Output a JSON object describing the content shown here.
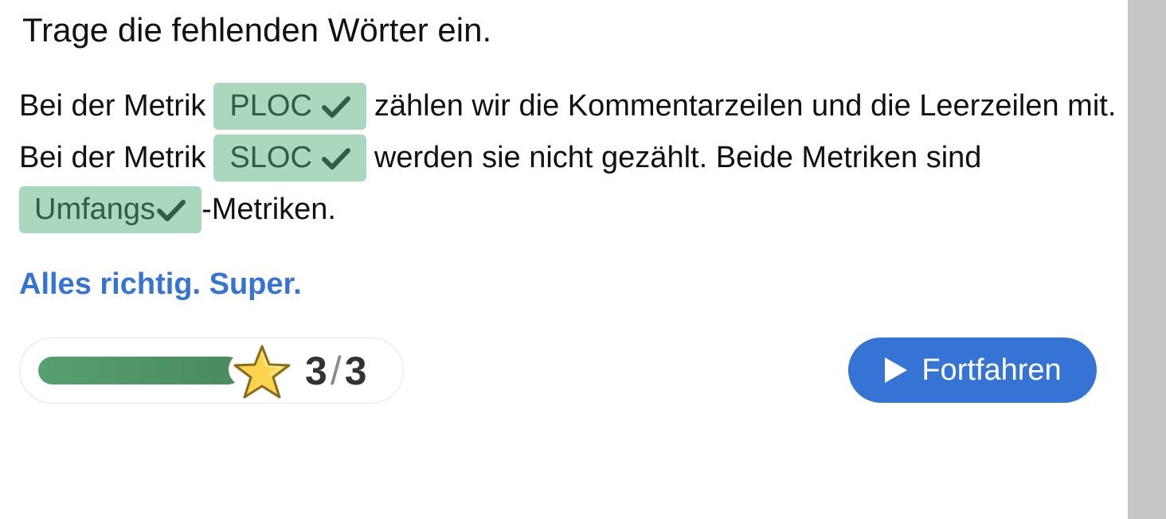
{
  "exercise": {
    "instruction": "Trage die fehlenden Wörter ein.",
    "line1": {
      "prefix": "Bei der Metrik",
      "answer": "PLOC",
      "suffix": "zählen wir die Kommentarzeilen und die Leerzeilen mit."
    },
    "line2": {
      "prefix": "Bei der Metrik",
      "answer": "SLOC",
      "suffix": "werden sie nicht gezählt. Beide Metriken sind"
    },
    "line3": {
      "answer": "Umfangs",
      "suffix": "-Metriken."
    },
    "feedback": "Alles richtig. Super."
  },
  "score": {
    "correct": "3",
    "separator": "/",
    "total": "3",
    "progress_fraction": 1.0
  },
  "actions": {
    "continue_label": "Fortfahren"
  },
  "colors": {
    "blank_bg": "#aad8be",
    "blank_text": "#2e5e44",
    "accent_blue": "#3574d4",
    "progress_green": "#56a06e",
    "star_yellow": "#fcd34d",
    "scrollbar": "#c6c6c6"
  },
  "icons": {
    "check": "check-icon",
    "star": "star-icon",
    "play": "play-icon"
  }
}
